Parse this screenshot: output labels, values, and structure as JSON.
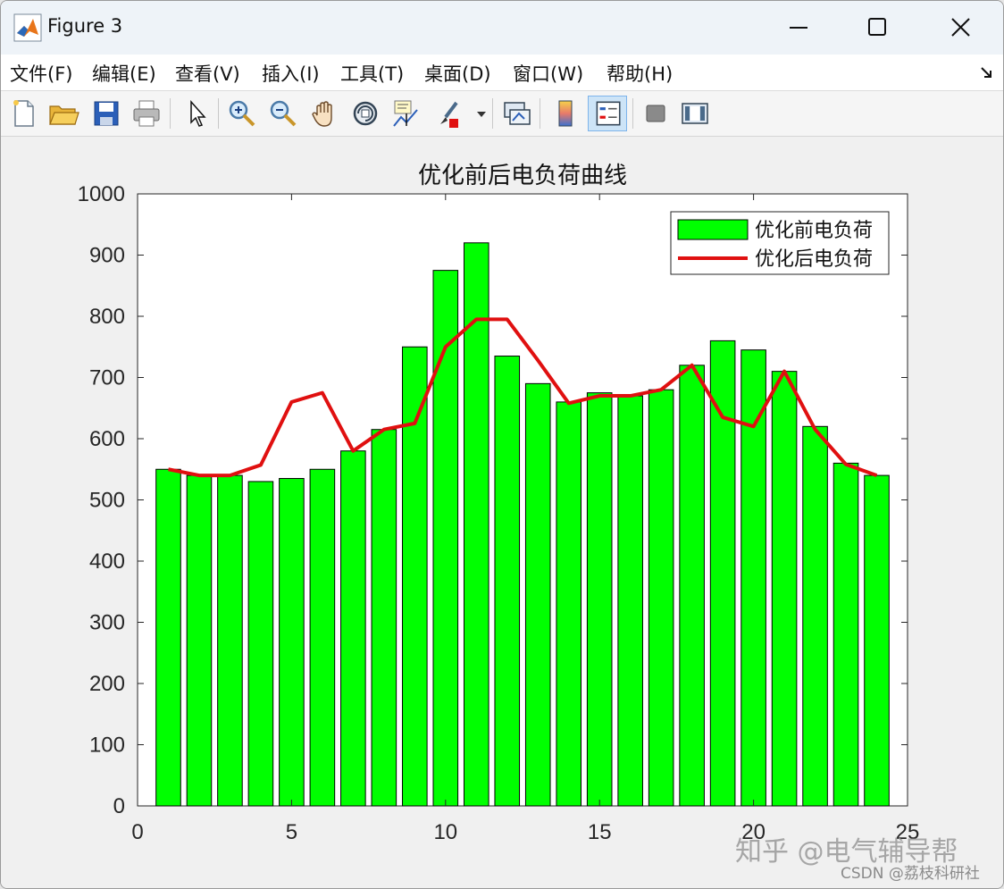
{
  "window": {
    "title": "Figure 3",
    "controls": {
      "minimize": "minimize-icon",
      "maximize": "maximize-icon",
      "close": "close-icon"
    }
  },
  "menu": [
    "文件(F)",
    "编辑(E)",
    "查看(V)",
    "插入(I)",
    "工具(T)",
    "桌面(D)",
    "窗口(W)",
    "帮助(H)"
  ],
  "toolbar": {
    "icons": [
      "new-figure-icon",
      "open-file-icon",
      "save-icon",
      "print-icon",
      "select-arrow-icon",
      "zoom-in-icon",
      "zoom-out-icon",
      "pan-hand-icon",
      "rotate-3d-icon",
      "data-cursor-icon",
      "brush-icon",
      "link-plot-icon",
      "colorbar-icon",
      "legend-icon",
      "hide-plot-tools-icon",
      "show-plot-tools-icon"
    ],
    "active": "legend-icon"
  },
  "chart_data": {
    "type": "bar",
    "title": "优化前后电负荷曲线",
    "xlabel": "",
    "ylabel": "",
    "x": [
      1,
      2,
      3,
      4,
      5,
      6,
      7,
      8,
      9,
      10,
      11,
      12,
      13,
      14,
      15,
      16,
      17,
      18,
      19,
      20,
      21,
      22,
      23,
      24
    ],
    "series": [
      {
        "name": "优化前电负荷",
        "type": "bar",
        "color": "#00ff00",
        "values": [
          550,
          540,
          540,
          530,
          535,
          550,
          580,
          615,
          750,
          875,
          920,
          735,
          690,
          660,
          675,
          670,
          680,
          720,
          760,
          745,
          710,
          620,
          560,
          540
        ]
      },
      {
        "name": "优化后电负荷",
        "type": "line",
        "color": "#e01010",
        "values": [
          550,
          540,
          540,
          557,
          660,
          675,
          580,
          615,
          625,
          750,
          795,
          795,
          728,
          658,
          670,
          670,
          680,
          720,
          635,
          620,
          710,
          615,
          558,
          540
        ]
      }
    ],
    "xlim": [
      0,
      25
    ],
    "ylim": [
      0,
      1000
    ],
    "xticks": [
      0,
      5,
      10,
      15,
      20,
      25
    ],
    "yticks": [
      0,
      100,
      200,
      300,
      400,
      500,
      600,
      700,
      800,
      900,
      1000
    ],
    "grid": false,
    "legend_position": "top-right"
  },
  "watermark": {
    "primary": "知乎 @电气辅导帮",
    "secondary": "CSDN @荔枝科研社"
  }
}
